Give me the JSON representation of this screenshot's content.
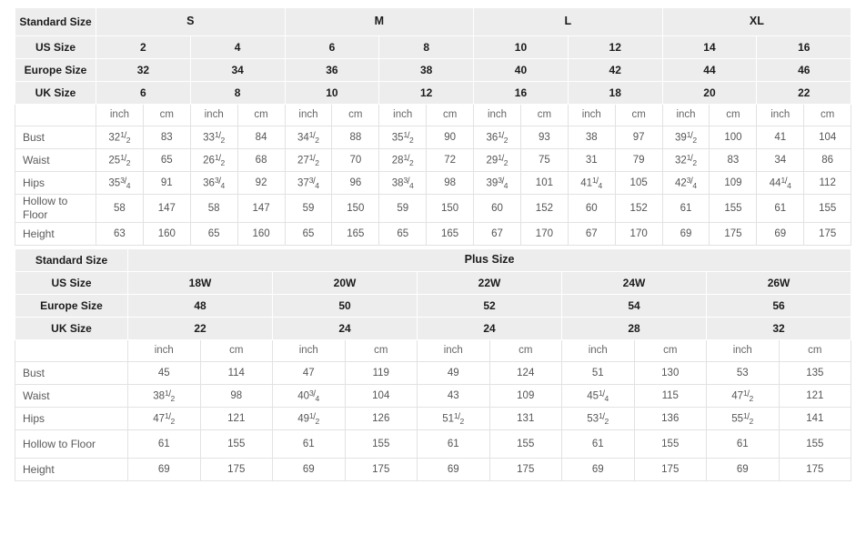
{
  "table1": {
    "name": "standard-size-table",
    "row_label_header": "Standard Size",
    "size_groups": [
      {
        "label": "S",
        "span": 2
      },
      {
        "label": "M",
        "span": 2
      },
      {
        "label": "L",
        "span": 2
      },
      {
        "label": "XL",
        "span": 2
      }
    ],
    "spec_rows": [
      {
        "label": "US Size",
        "values": [
          "2",
          "4",
          "6",
          "8",
          "10",
          "12",
          "14",
          "16"
        ]
      },
      {
        "label": "Europe Size",
        "values": [
          "32",
          "34",
          "36",
          "38",
          "40",
          "42",
          "44",
          "46"
        ]
      },
      {
        "label": "UK Size",
        "values": [
          "6",
          "8",
          "10",
          "12",
          "16",
          "18",
          "20",
          "22"
        ]
      }
    ],
    "unit_labels": [
      "inch",
      "cm",
      "inch",
      "cm",
      "inch",
      "cm",
      "inch",
      "cm",
      "inch",
      "cm",
      "inch",
      "cm",
      "inch",
      "cm",
      "inch",
      "cm"
    ],
    "measure_rows": [
      {
        "label": "Bust",
        "cells": [
          {
            "whole": "32",
            "num": "1",
            "den": "2"
          },
          {
            "whole": "83"
          },
          {
            "whole": "33",
            "num": "1",
            "den": "2"
          },
          {
            "whole": "84"
          },
          {
            "whole": "34",
            "num": "1",
            "den": "2"
          },
          {
            "whole": "88"
          },
          {
            "whole": "35",
            "num": "1",
            "den": "2"
          },
          {
            "whole": "90"
          },
          {
            "whole": "36",
            "num": "1",
            "den": "2"
          },
          {
            "whole": "93"
          },
          {
            "whole": "38"
          },
          {
            "whole": "97"
          },
          {
            "whole": "39",
            "num": "1",
            "den": "2"
          },
          {
            "whole": "100"
          },
          {
            "whole": "41"
          },
          {
            "whole": "104"
          }
        ]
      },
      {
        "label": "Waist",
        "cells": [
          {
            "whole": "25",
            "num": "1",
            "den": "2"
          },
          {
            "whole": "65"
          },
          {
            "whole": "26",
            "num": "1",
            "den": "2"
          },
          {
            "whole": "68"
          },
          {
            "whole": "27",
            "num": "1",
            "den": "2"
          },
          {
            "whole": "70"
          },
          {
            "whole": "28",
            "num": "1",
            "den": "2"
          },
          {
            "whole": "72"
          },
          {
            "whole": "29",
            "num": "1",
            "den": "2"
          },
          {
            "whole": "75"
          },
          {
            "whole": "31"
          },
          {
            "whole": "79"
          },
          {
            "whole": "32",
            "num": "1",
            "den": "2"
          },
          {
            "whole": "83"
          },
          {
            "whole": "34"
          },
          {
            "whole": "86"
          }
        ]
      },
      {
        "label": "Hips",
        "cells": [
          {
            "whole": "35",
            "num": "3",
            "den": "4"
          },
          {
            "whole": "91"
          },
          {
            "whole": "36",
            "num": "3",
            "den": "4"
          },
          {
            "whole": "92"
          },
          {
            "whole": "37",
            "num": "3",
            "den": "4"
          },
          {
            "whole": "96"
          },
          {
            "whole": "38",
            "num": "3",
            "den": "4"
          },
          {
            "whole": "98"
          },
          {
            "whole": "39",
            "num": "3",
            "den": "4"
          },
          {
            "whole": "101"
          },
          {
            "whole": "41",
            "num": "1",
            "den": "4"
          },
          {
            "whole": "105"
          },
          {
            "whole": "42",
            "num": "3",
            "den": "4"
          },
          {
            "whole": "109"
          },
          {
            "whole": "44",
            "num": "1",
            "den": "4"
          },
          {
            "whole": "112"
          }
        ]
      },
      {
        "label": "Hollow to Floor",
        "cells": [
          {
            "whole": "58"
          },
          {
            "whole": "147"
          },
          {
            "whole": "58"
          },
          {
            "whole": "147"
          },
          {
            "whole": "59"
          },
          {
            "whole": "150"
          },
          {
            "whole": "59"
          },
          {
            "whole": "150"
          },
          {
            "whole": "60"
          },
          {
            "whole": "152"
          },
          {
            "whole": "60"
          },
          {
            "whole": "152"
          },
          {
            "whole": "61"
          },
          {
            "whole": "155"
          },
          {
            "whole": "61"
          },
          {
            "whole": "155"
          }
        ]
      },
      {
        "label": "Height",
        "cells": [
          {
            "whole": "63"
          },
          {
            "whole": "160"
          },
          {
            "whole": "65"
          },
          {
            "whole": "160"
          },
          {
            "whole": "65"
          },
          {
            "whole": "165"
          },
          {
            "whole": "65"
          },
          {
            "whole": "165"
          },
          {
            "whole": "67"
          },
          {
            "whole": "170"
          },
          {
            "whole": "67"
          },
          {
            "whole": "170"
          },
          {
            "whole": "69"
          },
          {
            "whole": "175"
          },
          {
            "whole": "69"
          },
          {
            "whole": "175"
          }
        ]
      }
    ]
  },
  "table2": {
    "name": "plus-size-table",
    "row_label_header": "Standard Size",
    "group_label": "Plus Size",
    "spec_rows": [
      {
        "label": "US Size",
        "values": [
          "18W",
          "20W",
          "22W",
          "24W",
          "26W"
        ]
      },
      {
        "label": "Europe Size",
        "values": [
          "48",
          "50",
          "52",
          "54",
          "56"
        ]
      },
      {
        "label": "UK Size",
        "values": [
          "22",
          "24",
          "24",
          "28",
          "32"
        ]
      }
    ],
    "unit_labels": [
      "inch",
      "cm",
      "inch",
      "cm",
      "inch",
      "cm",
      "inch",
      "cm",
      "inch",
      "cm"
    ],
    "measure_rows": [
      {
        "label": "Bust",
        "cells": [
          {
            "whole": "45"
          },
          {
            "whole": "114"
          },
          {
            "whole": "47"
          },
          {
            "whole": "119"
          },
          {
            "whole": "49"
          },
          {
            "whole": "124"
          },
          {
            "whole": "51"
          },
          {
            "whole": "130"
          },
          {
            "whole": "53"
          },
          {
            "whole": "135"
          }
        ]
      },
      {
        "label": "Waist",
        "cells": [
          {
            "whole": "38",
            "num": "1",
            "den": "2"
          },
          {
            "whole": "98"
          },
          {
            "whole": "40",
            "num": "3",
            "den": "4"
          },
          {
            "whole": "104"
          },
          {
            "whole": "43"
          },
          {
            "whole": "109"
          },
          {
            "whole": "45",
            "num": "1",
            "den": "4"
          },
          {
            "whole": "115"
          },
          {
            "whole": "47",
            "num": "1",
            "den": "2"
          },
          {
            "whole": "121"
          }
        ]
      },
      {
        "label": "Hips",
        "cells": [
          {
            "whole": "47",
            "num": "1",
            "den": "2"
          },
          {
            "whole": "121"
          },
          {
            "whole": "49",
            "num": "1",
            "den": "2"
          },
          {
            "whole": "126"
          },
          {
            "whole": "51",
            "num": "1",
            "den": "2"
          },
          {
            "whole": "131"
          },
          {
            "whole": "53",
            "num": "1",
            "den": "2"
          },
          {
            "whole": "136"
          },
          {
            "whole": "55",
            "num": "1",
            "den": "2"
          },
          {
            "whole": "141"
          }
        ]
      },
      {
        "label": "Hollow to Floor",
        "cells": [
          {
            "whole": "61"
          },
          {
            "whole": "155"
          },
          {
            "whole": "61"
          },
          {
            "whole": "155"
          },
          {
            "whole": "61"
          },
          {
            "whole": "155"
          },
          {
            "whole": "61"
          },
          {
            "whole": "155"
          },
          {
            "whole": "61"
          },
          {
            "whole": "155"
          }
        ]
      },
      {
        "label": "Height",
        "cells": [
          {
            "whole": "69"
          },
          {
            "whole": "175"
          },
          {
            "whole": "69"
          },
          {
            "whole": "175"
          },
          {
            "whole": "69"
          },
          {
            "whole": "175"
          },
          {
            "whole": "69"
          },
          {
            "whole": "175"
          },
          {
            "whole": "69"
          },
          {
            "whole": "175"
          }
        ]
      }
    ]
  },
  "colors": {
    "header_bg": "#ededed",
    "cell_bg": "#ffffff",
    "cell_border": "#e2e2e2",
    "outer_border": "#c9c9c9",
    "header_text": "#1b1b1b",
    "body_text": "#555555"
  }
}
